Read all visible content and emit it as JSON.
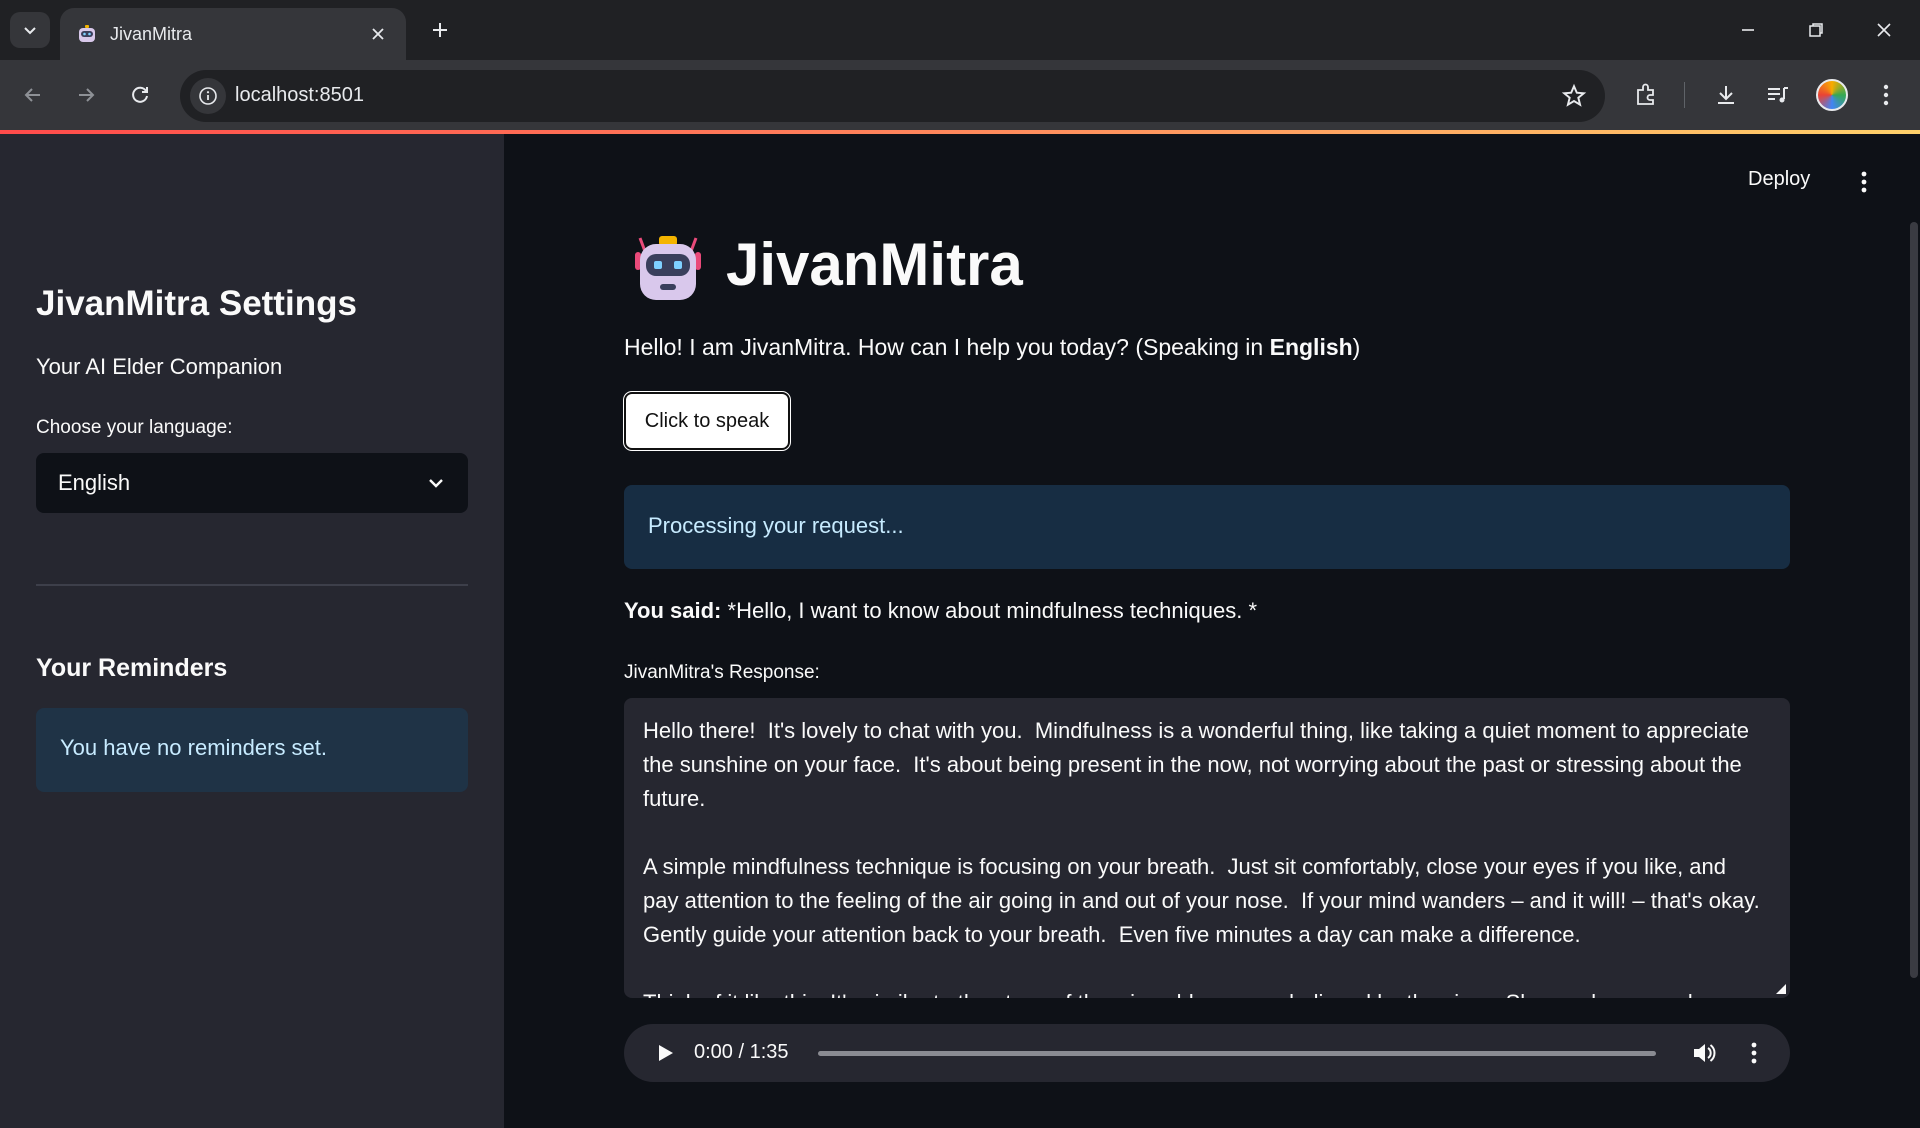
{
  "browser": {
    "tab_title": "JivanMitra",
    "url": "localhost:8501"
  },
  "sidebar": {
    "title": "JivanMitra Settings",
    "subtitle": "Your AI Elder Companion",
    "language_label": "Choose your language:",
    "language_value": "English",
    "reminders_heading": "Your Reminders",
    "reminders_info": "You have no reminders set."
  },
  "header": {
    "deploy_label": "Deploy"
  },
  "main": {
    "title": "JivanMitra",
    "greeting_prefix": "Hello! I am JivanMitra. How can I help you today? (Speaking in ",
    "greeting_language": "English",
    "greeting_suffix": ")",
    "speak_button": "Click to speak",
    "processing_text": "Processing your request...",
    "you_said_label": "You said:",
    "you_said_text": " *Hello, I want to know about mindfulness techniques. *",
    "response_label": "JivanMitra's Response:",
    "response_text": "Hello there!  It's lovely to chat with you.  Mindfulness is a wonderful thing, like taking a quiet moment to appreciate the sunshine on your face.  It's about being present in the now, not worrying about the past or stressing about the future.\n\nA simple mindfulness technique is focusing on your breath.  Just sit comfortably, close your eyes if you like, and pay attention to the feeling of the air going in and out of your nose.  If your mind wanders – and it will! – that's okay.  Gently guide your attention back to your breath.  Even five minutes a day can make a difference.\n\nThink of it like this: It's similar to the steps of the wise old ones, as believed by the sixes. Slow and ease and"
  },
  "audio": {
    "time": "0:00 / 1:35",
    "progress": 0
  },
  "colors": {
    "accent_gradient_start": "#ff4b4b",
    "accent_gradient_end": "#ffd16a",
    "info_background": "#1f3346",
    "info_text": "#c7ebff"
  }
}
